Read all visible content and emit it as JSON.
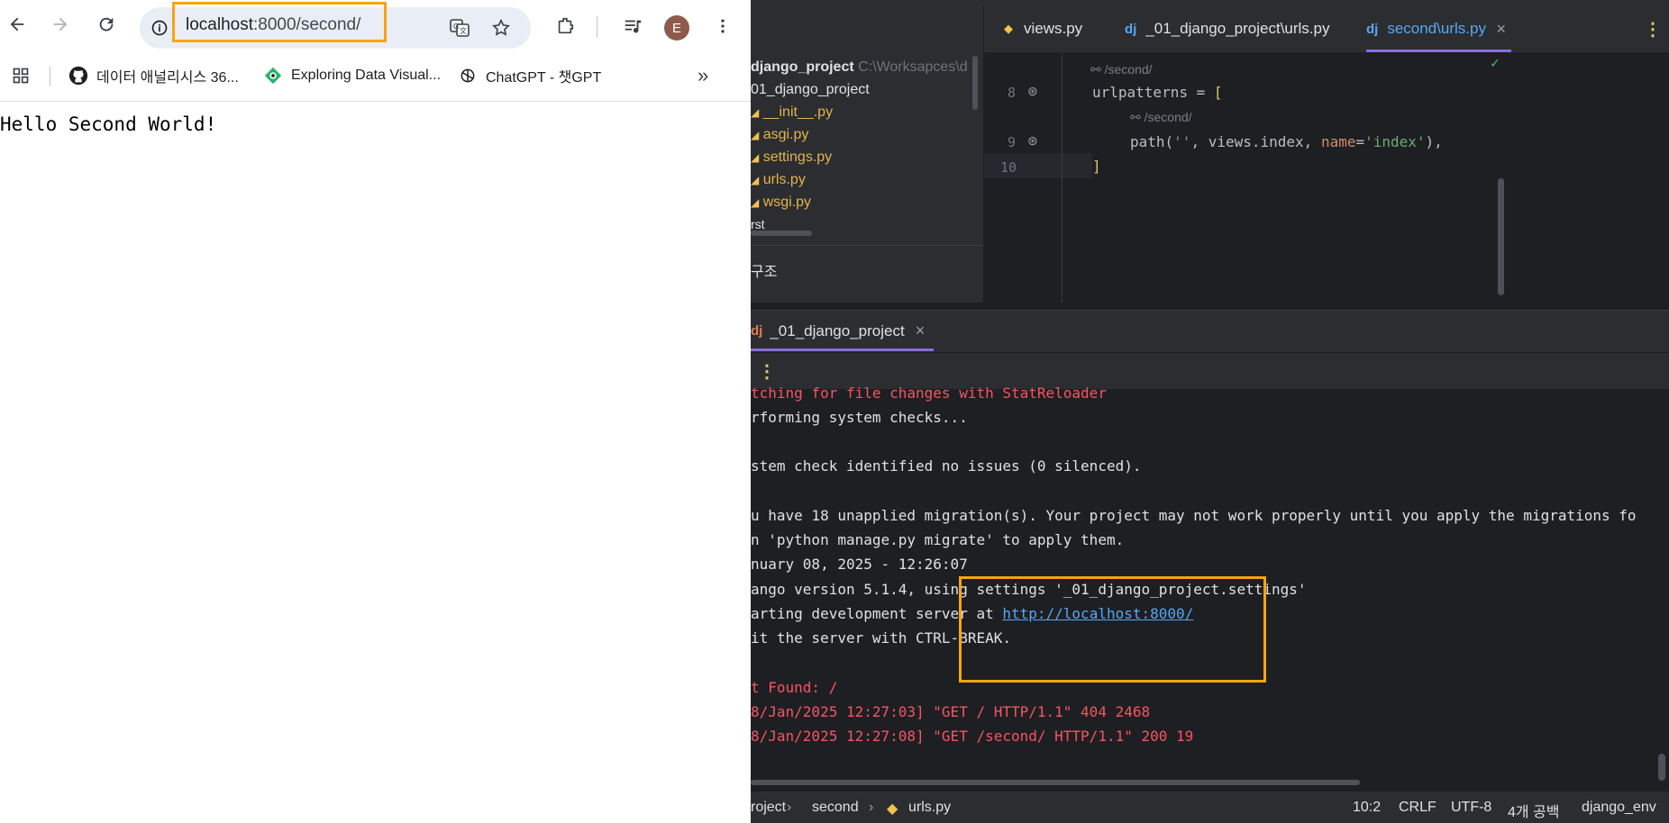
{
  "browser": {
    "nav": {
      "back_icon": "arrow-left-icon",
      "forward_icon": "arrow-right-icon",
      "reload_icon": "reload-icon"
    },
    "address_bar": {
      "url_host": "localhost",
      "url_rest": ":8000/second/"
    },
    "toolbar_icons": [
      "site-info-icon",
      "translate-icon",
      "bookmark-star-icon",
      "extensions-icon",
      "media-queue-icon",
      "more-menu-icon"
    ],
    "profile_initial": "E",
    "bookmarks": [
      {
        "label": "데이터 애널리시스 36...",
        "icon": "github-icon"
      },
      {
        "label": "Exploring Data Visual...",
        "icon": "exploring-icon"
      },
      {
        "label": "ChatGPT - 챗GPT",
        "icon": "chatgpt-icon"
      }
    ],
    "bookmarks_overflow": "»",
    "page_text": "Hello Second World!"
  },
  "ide": {
    "project_tree": [
      {
        "label": "django_project",
        "path": "C:\\Worksapces\\d",
        "kind": "folder"
      },
      {
        "label": "01_django_project",
        "kind": "folder"
      },
      {
        "label": "__init__.py",
        "kind": "py"
      },
      {
        "label": "asgi.py",
        "kind": "py"
      },
      {
        "label": "settings.py",
        "kind": "py"
      },
      {
        "label": "urls.py",
        "kind": "py"
      },
      {
        "label": "wsgi.py",
        "kind": "py"
      },
      {
        "label": "rst",
        "kind": "folder"
      }
    ],
    "structure_label": "구조",
    "editor_tabs": [
      {
        "label": "views.py",
        "icon": "python-file-icon",
        "active": false
      },
      {
        "label": "_01_django_project\\urls.py",
        "icon": "django-icon",
        "active": false
      },
      {
        "label": "second\\urls.py",
        "icon": "django-icon",
        "active": true
      }
    ],
    "editor_close": "×",
    "editor_more": "⋮",
    "code": {
      "hint_top": "/second/",
      "line8_no": "8",
      "line8": "urlpatterns = ",
      "line8_bracket": "[",
      "hint_mid": "/second/",
      "line9_no": "9",
      "line9_path": "path(",
      "line9_arg1": "''",
      "line9_mid": ", views.index, ",
      "line9_kw": "name",
      "line9_eq": "=",
      "line9_arg2": "'index'",
      "line9_end": "),",
      "line10_no": "10",
      "line10": "]"
    },
    "run_tab": {
      "label": "_01_django_project",
      "close": "×"
    },
    "console": {
      "lines": [
        {
          "text": "tching for file changes with StatReloader",
          "red": true
        },
        {
          "text": "rforming system checks...",
          "red": false
        },
        {
          "text": "",
          "red": false
        },
        {
          "text": "stem check identified no issues (0 silenced).",
          "red": false
        },
        {
          "text": "",
          "red": false
        },
        {
          "text": "u have 18 unapplied migration(s). Your project may not work properly until you apply the migrations fo",
          "red": false
        },
        {
          "text": "n 'python manage.py migrate' to apply them.",
          "red": false
        },
        {
          "text": "nuary 08, 2025 - 12:26:07",
          "red": false
        },
        {
          "text": "ango version 5.1.4, using settings '_01_django_project.settings'",
          "red": false
        }
      ],
      "server_prefix": "arting development server at ",
      "server_link": "http://localhost:8000/",
      "quit_line": "it the server with CTRL-BREAK.",
      "notfound": "t Found: /",
      "log1": "8/Jan/2025 12:27:03] \"GET / HTTP/1.1\" 404 2468",
      "log2": "8/Jan/2025 12:27:08] \"GET /second/ HTTP/1.1\" 200 19"
    },
    "status": {
      "crumb1": "roject",
      "crumb2": "second",
      "crumb3": "urls.py",
      "position": "10:2",
      "line_ending": "CRLF",
      "encoding": "UTF-8",
      "indent": "4개 공백",
      "interpreter": "django_env"
    }
  }
}
